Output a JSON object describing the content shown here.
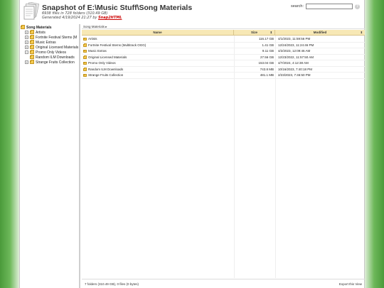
{
  "header": {
    "title": "Snapshot of E:\\Music Stuff\\Song Materials",
    "stats": "6938 files in 728 folders (310.49 GB)",
    "generated_prefix": "Generated 4/19/2024 21:27 by",
    "generator_link": "Snap2HTML",
    "search_label": "search:",
    "search_value": "",
    "help_icon": "?"
  },
  "sidebar": {
    "root": "Song Materials",
    "items": [
      {
        "label": "Artists",
        "expander": "+"
      },
      {
        "label": "Fortnite Festival Stems (M",
        "expander": "+"
      },
      {
        "label": "Music Extras",
        "expander": "+"
      },
      {
        "label": "Original Licensed Materials",
        "expander": "+"
      },
      {
        "label": "Promo Only Videos",
        "expander": "−"
      },
      {
        "label": "Random ILM Downloads",
        "expander": ""
      },
      {
        "label": "Strange Fruits Collection",
        "expander": "+"
      }
    ]
  },
  "main": {
    "breadcrumb": "Song Materials ▸",
    "columns": {
      "name": "Name",
      "size": "Size",
      "modified": "Modified"
    },
    "sort_arrow": "⬍",
    "rows": [
      {
        "name": "Artists",
        "size": "116.17 GB",
        "modified": "4/1/2023, 11:59:56 PM"
      },
      {
        "name": "Fortnite Festival Stems (Multitrack OGG)",
        "size": "1.41 GB",
        "modified": "12/24/2023, 11:24:46 PM"
      },
      {
        "name": "Music Extras",
        "size": "9.11 GB",
        "modified": "4/2/2023, 12:09:46 AM"
      },
      {
        "name": "Original Licensed Materials",
        "size": "27.56 GB",
        "modified": "12/23/2022, 11:57:50 AM"
      },
      {
        "name": "Promo Only Videos",
        "size": "153.04 GB",
        "modified": "4/7/2024, 4:12:38 AM"
      },
      {
        "name": "Random ILM Downloads",
        "size": "743.8 MB",
        "modified": "10/16/2023, 7:40:18 PM"
      },
      {
        "name": "Strange Fruits Collection",
        "size": "481.1 MB",
        "modified": "2/23/2023, 7:46:50 PM"
      }
    ],
    "footer_summary": "7 folders (310.49 GB), 0 files (0 bytes)",
    "export_label": "Export this View"
  },
  "colors": {
    "header_bg": "#f7e8b5",
    "folder": "#f4c94e",
    "link": "#cc0000",
    "background_green": "#4a9a3a"
  }
}
